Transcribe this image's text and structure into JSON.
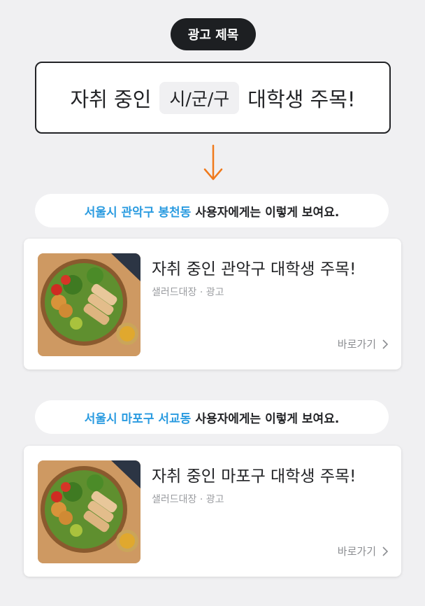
{
  "header_label": "광고 제목",
  "template": {
    "prefix": "자취 중인",
    "placeholder": "시/군/구",
    "suffix": "대학생 주목!"
  },
  "arrow_color": "#f07a1c",
  "accent_color": "#2a9be0",
  "examples": [
    {
      "location": "서울시 관악구 봉천동",
      "caption": "사용자에게는 이렇게 보여요.",
      "ad": {
        "title": "자취 중인 관악구 대학생 주목!",
        "meta": "샐러드대장 · 광고",
        "cta": "바로가기"
      }
    },
    {
      "location": "서울시 마포구 서교동",
      "caption": "사용자에게는 이렇게 보여요.",
      "ad": {
        "title": "자취 중인 마포구 대학생 주목!",
        "meta": "샐러드대장 · 광고",
        "cta": "바로가기"
      }
    }
  ]
}
